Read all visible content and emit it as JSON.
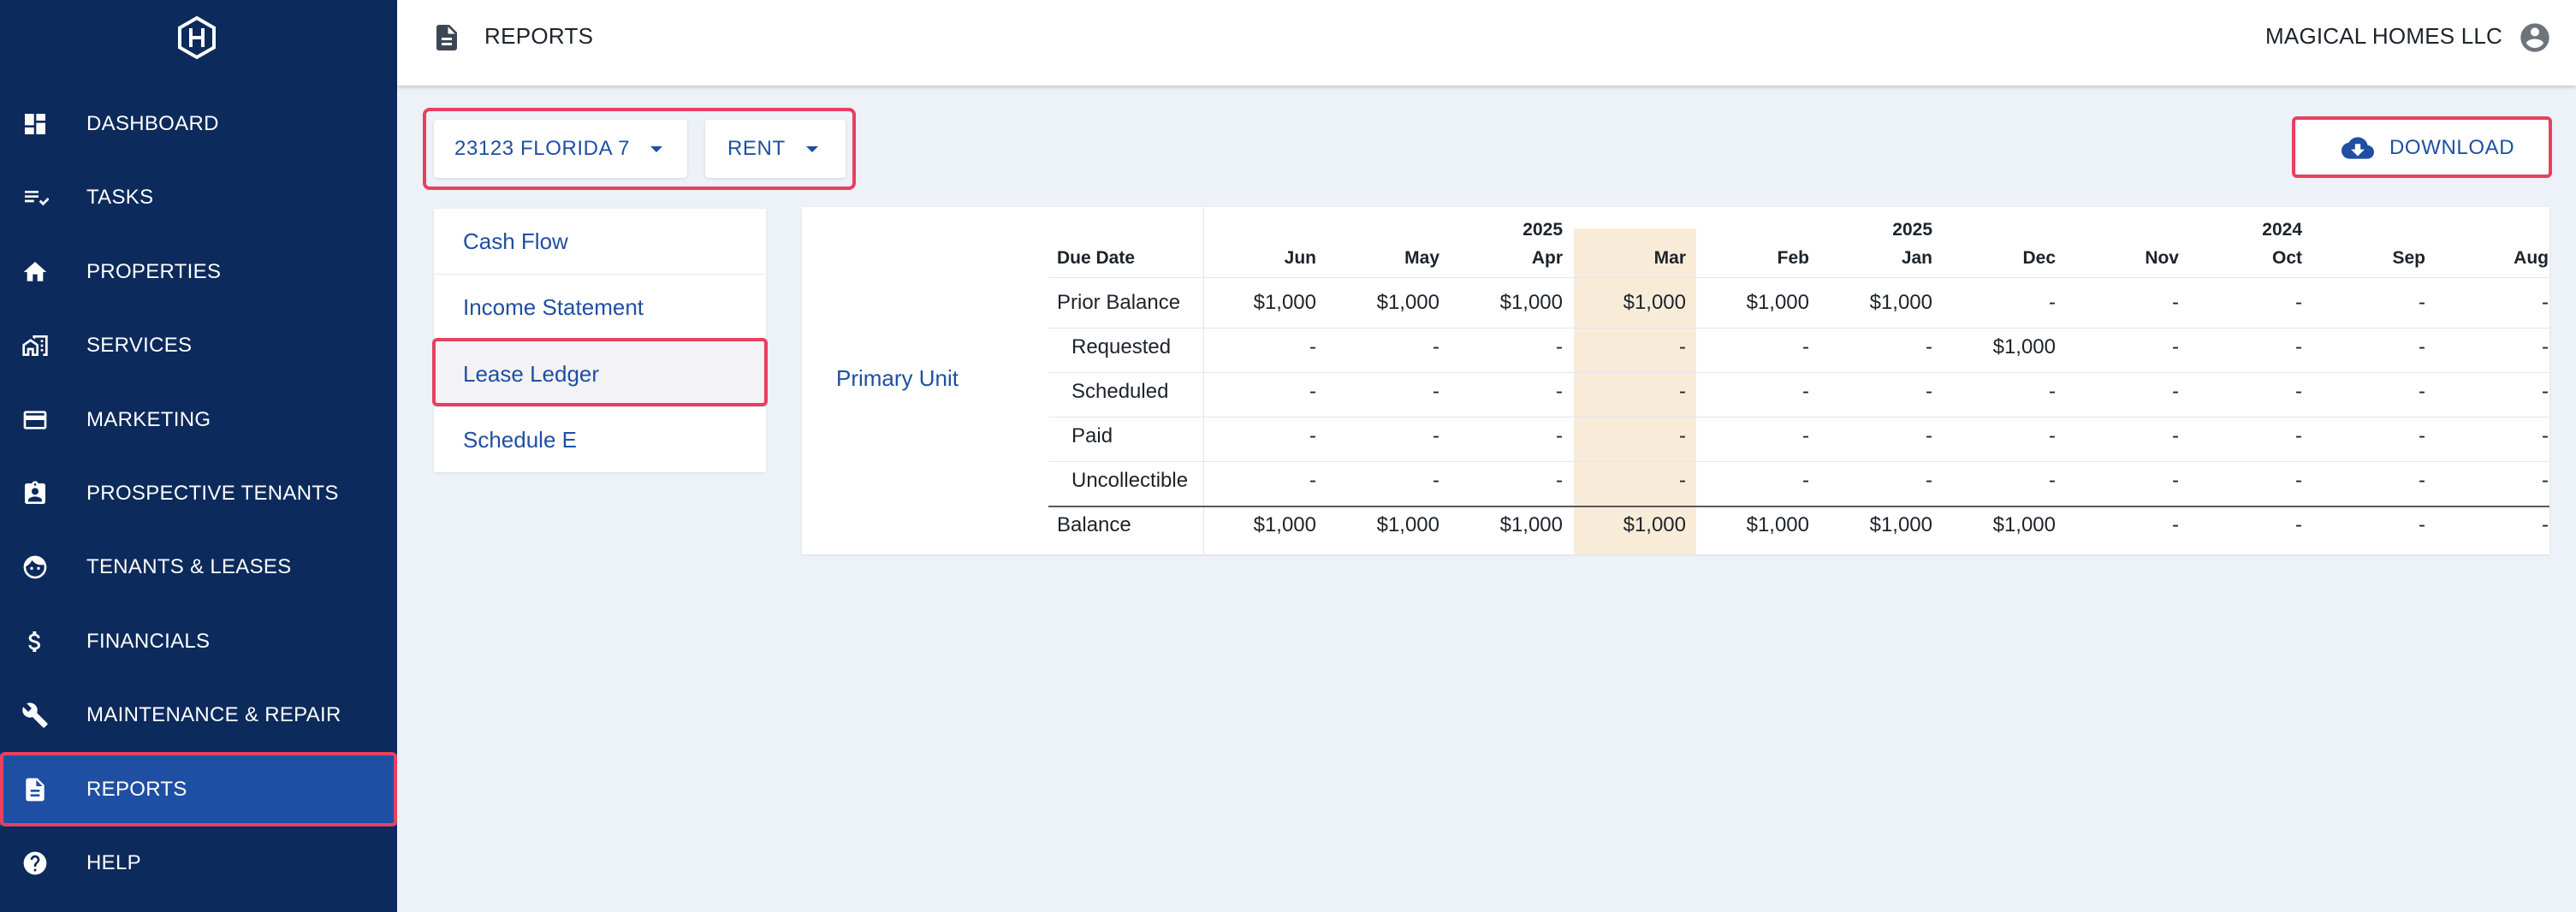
{
  "app": {
    "title": "REPORTS",
    "company": "MAGICAL HOMES LLC"
  },
  "sidebar": {
    "items": [
      {
        "label": "DASHBOARD",
        "icon": "dashboard-icon"
      },
      {
        "label": "TASKS",
        "icon": "tasks-icon"
      },
      {
        "label": "PROPERTIES",
        "icon": "home-icon"
      },
      {
        "label": "SERVICES",
        "icon": "services-icon"
      },
      {
        "label": "MARKETING",
        "icon": "marketing-icon"
      },
      {
        "label": "PROSPECTIVE TENANTS",
        "icon": "clipboard-icon"
      },
      {
        "label": "TENANTS & LEASES",
        "icon": "face-icon"
      },
      {
        "label": "FINANCIALS",
        "icon": "dollar-icon"
      },
      {
        "label": "MAINTENANCE & REPAIR",
        "icon": "wrench-icon"
      },
      {
        "label": "REPORTS",
        "icon": "document-icon"
      },
      {
        "label": "HELP",
        "icon": "help-icon"
      }
    ],
    "active": "REPORTS"
  },
  "filters": {
    "property": "23123 FLORIDA 7",
    "type": "RENT"
  },
  "download": {
    "label": "DOWNLOAD"
  },
  "reports": {
    "items": [
      "Cash Flow",
      "Income Statement",
      "Lease Ledger",
      "Schedule E"
    ],
    "active": "Lease Ledger"
  },
  "ledger": {
    "unit": "Primary Unit",
    "due_date_label": "Due Date",
    "months": [
      "Jun",
      "May",
      "Apr",
      "Mar",
      "Feb",
      "Jan",
      "Dec",
      "Nov",
      "Oct",
      "Sep",
      "Aug"
    ],
    "year_labels": {
      "2": "2025",
      "5": "2025",
      "8": "2024"
    },
    "highlight_month": "Mar",
    "rows": [
      {
        "label": "Prior Balance",
        "values": [
          "$1,000",
          "$1,000",
          "$1,000",
          "$1,000",
          "$1,000",
          "$1,000",
          "-",
          "-",
          "-",
          "-",
          "-"
        ]
      },
      {
        "label": "Requested",
        "values": [
          "-",
          "-",
          "-",
          "-",
          "-",
          "-",
          "$1,000",
          "-",
          "-",
          "-",
          "-"
        ]
      },
      {
        "label": "Scheduled",
        "values": [
          "-",
          "-",
          "-",
          "-",
          "-",
          "-",
          "-",
          "-",
          "-",
          "-",
          "-"
        ]
      },
      {
        "label": "Paid",
        "values": [
          "-",
          "-",
          "-",
          "-",
          "-",
          "-",
          "-",
          "-",
          "-",
          "-",
          "-"
        ]
      },
      {
        "label": "Uncollectible",
        "values": [
          "-",
          "-",
          "-",
          "-",
          "-",
          "-",
          "-",
          "-",
          "-",
          "-",
          "-"
        ]
      },
      {
        "label": "Balance",
        "values": [
          "$1,000",
          "$1,000",
          "$1,000",
          "$1,000",
          "$1,000",
          "$1,000",
          "$1,000",
          "-",
          "-",
          "-",
          "-"
        ]
      }
    ]
  }
}
